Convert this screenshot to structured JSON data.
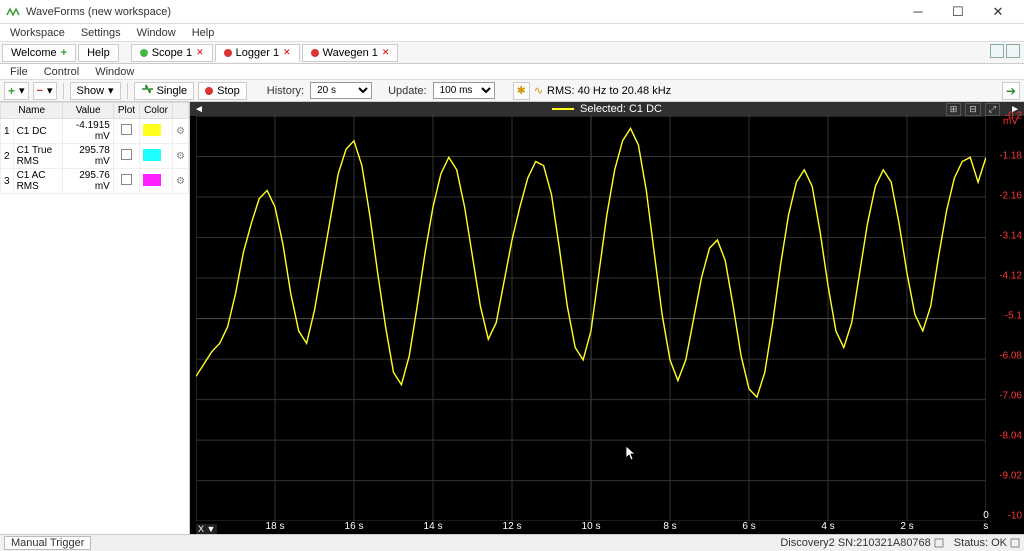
{
  "window": {
    "title": "WaveForms (new workspace)"
  },
  "menu": {
    "items": [
      "Workspace",
      "Settings",
      "Window",
      "Help"
    ]
  },
  "tabs": {
    "welcome": "Welcome",
    "help": "Help",
    "scope": "Scope 1",
    "logger": "Logger 1",
    "wavegen": "Wavegen 1"
  },
  "submenu": {
    "items": [
      "File",
      "Control",
      "Window"
    ]
  },
  "toolbar": {
    "show": "Show",
    "single": "Single",
    "stop": "Stop",
    "history_label": "History:",
    "history_value": "20 s",
    "update_label": "Update:",
    "update_value": "100 ms",
    "rms_label": "RMS: 40 Hz to 20.48 kHz"
  },
  "channels": {
    "headers": [
      "Name",
      "Value",
      "Plot",
      "Color"
    ],
    "rows": [
      {
        "idx": "1",
        "name": "C1 DC",
        "value": "-4.1915 mV",
        "color": "#ffff20"
      },
      {
        "idx": "2",
        "name": "C1 True RMS",
        "value": "295.78 mV",
        "color": "#20ffff"
      },
      {
        "idx": "3",
        "name": "C1 AC RMS",
        "value": "295.76 mV",
        "color": "#ff20ff"
      }
    ]
  },
  "plot": {
    "selected_label": "Selected: C1 DC",
    "y_unit": "mV",
    "y_ticks": [
      "-0.2",
      "-1.18",
      "-2.16",
      "-3.14",
      "-4.12",
      "-5.1",
      "-6.08",
      "-7.06",
      "-8.04",
      "-9.02",
      "-10"
    ],
    "x_ticks": [
      "18 s",
      "16 s",
      "14 s",
      "12 s",
      "10 s",
      "8 s",
      "6 s",
      "4 s",
      "2 s",
      "0 s"
    ],
    "x_ctrl": "X ▼"
  },
  "status": {
    "manual_trigger": "Manual Trigger",
    "device": "Discovery2 SN:210321A80768",
    "status": "Status: OK"
  },
  "chart_data": {
    "type": "line",
    "title": "Selected: C1 DC",
    "ylabel": "mV",
    "xlabel": "",
    "ylim": [
      -10,
      -0.2
    ],
    "xlim": [
      20,
      0
    ],
    "x": [
      20,
      19.8,
      19.6,
      19.4,
      19.2,
      19,
      18.8,
      18.6,
      18.4,
      18.2,
      18,
      17.8,
      17.6,
      17.4,
      17.2,
      17,
      16.8,
      16.6,
      16.4,
      16.2,
      16,
      15.8,
      15.6,
      15.4,
      15.2,
      15,
      14.8,
      14.6,
      14.4,
      14.2,
      14,
      13.8,
      13.6,
      13.4,
      13.2,
      13,
      12.8,
      12.6,
      12.4,
      12.2,
      12,
      11.8,
      11.6,
      11.4,
      11.2,
      11,
      10.8,
      10.6,
      10.4,
      10.2,
      10,
      9.8,
      9.6,
      9.4,
      9.2,
      9,
      8.8,
      8.6,
      8.4,
      8.2,
      8,
      7.8,
      7.6,
      7.4,
      7.2,
      7,
      6.8,
      6.6,
      6.4,
      6.2,
      6,
      5.8,
      5.6,
      5.4,
      5.2,
      5,
      4.8,
      4.6,
      4.4,
      4.2,
      4,
      3.8,
      3.6,
      3.4,
      3.2,
      3,
      2.8,
      2.6,
      2.4,
      2.2,
      2,
      1.8,
      1.6,
      1.4,
      1.2,
      1,
      0.8,
      0.6,
      0.4,
      0.2,
      0
    ],
    "values": [
      -6.5,
      -6.2,
      -5.9,
      -5.7,
      -5.3,
      -4.5,
      -3.5,
      -2.8,
      -2.2,
      -2.0,
      -2.4,
      -3.3,
      -4.5,
      -5.4,
      -5.7,
      -4.9,
      -3.8,
      -2.7,
      -1.6,
      -1.0,
      -0.8,
      -1.4,
      -2.6,
      -4.0,
      -5.3,
      -6.4,
      -6.7,
      -6.0,
      -4.8,
      -3.5,
      -2.4,
      -1.6,
      -1.2,
      -1.5,
      -2.4,
      -3.6,
      -4.8,
      -5.6,
      -5.2,
      -4.2,
      -3.2,
      -2.4,
      -1.7,
      -1.3,
      -1.4,
      -2.1,
      -3.4,
      -4.8,
      -5.8,
      -6.1,
      -5.4,
      -4.0,
      -2.6,
      -1.5,
      -0.8,
      -0.5,
      -0.9,
      -2.0,
      -3.5,
      -5.0,
      -6.1,
      -6.6,
      -6.1,
      -5.1,
      -4.1,
      -3.4,
      -3.2,
      -3.7,
      -4.8,
      -6.0,
      -6.8,
      -7.0,
      -6.4,
      -5.2,
      -3.8,
      -2.6,
      -1.8,
      -1.5,
      -1.9,
      -3.0,
      -4.3,
      -5.4,
      -5.8,
      -5.2,
      -4.0,
      -2.8,
      -1.9,
      -1.5,
      -1.8,
      -2.8,
      -4.0,
      -5.0,
      -5.4,
      -4.8,
      -3.6,
      -2.5,
      -1.7,
      -1.3,
      -1.2,
      -1.8,
      -1.2
    ]
  }
}
